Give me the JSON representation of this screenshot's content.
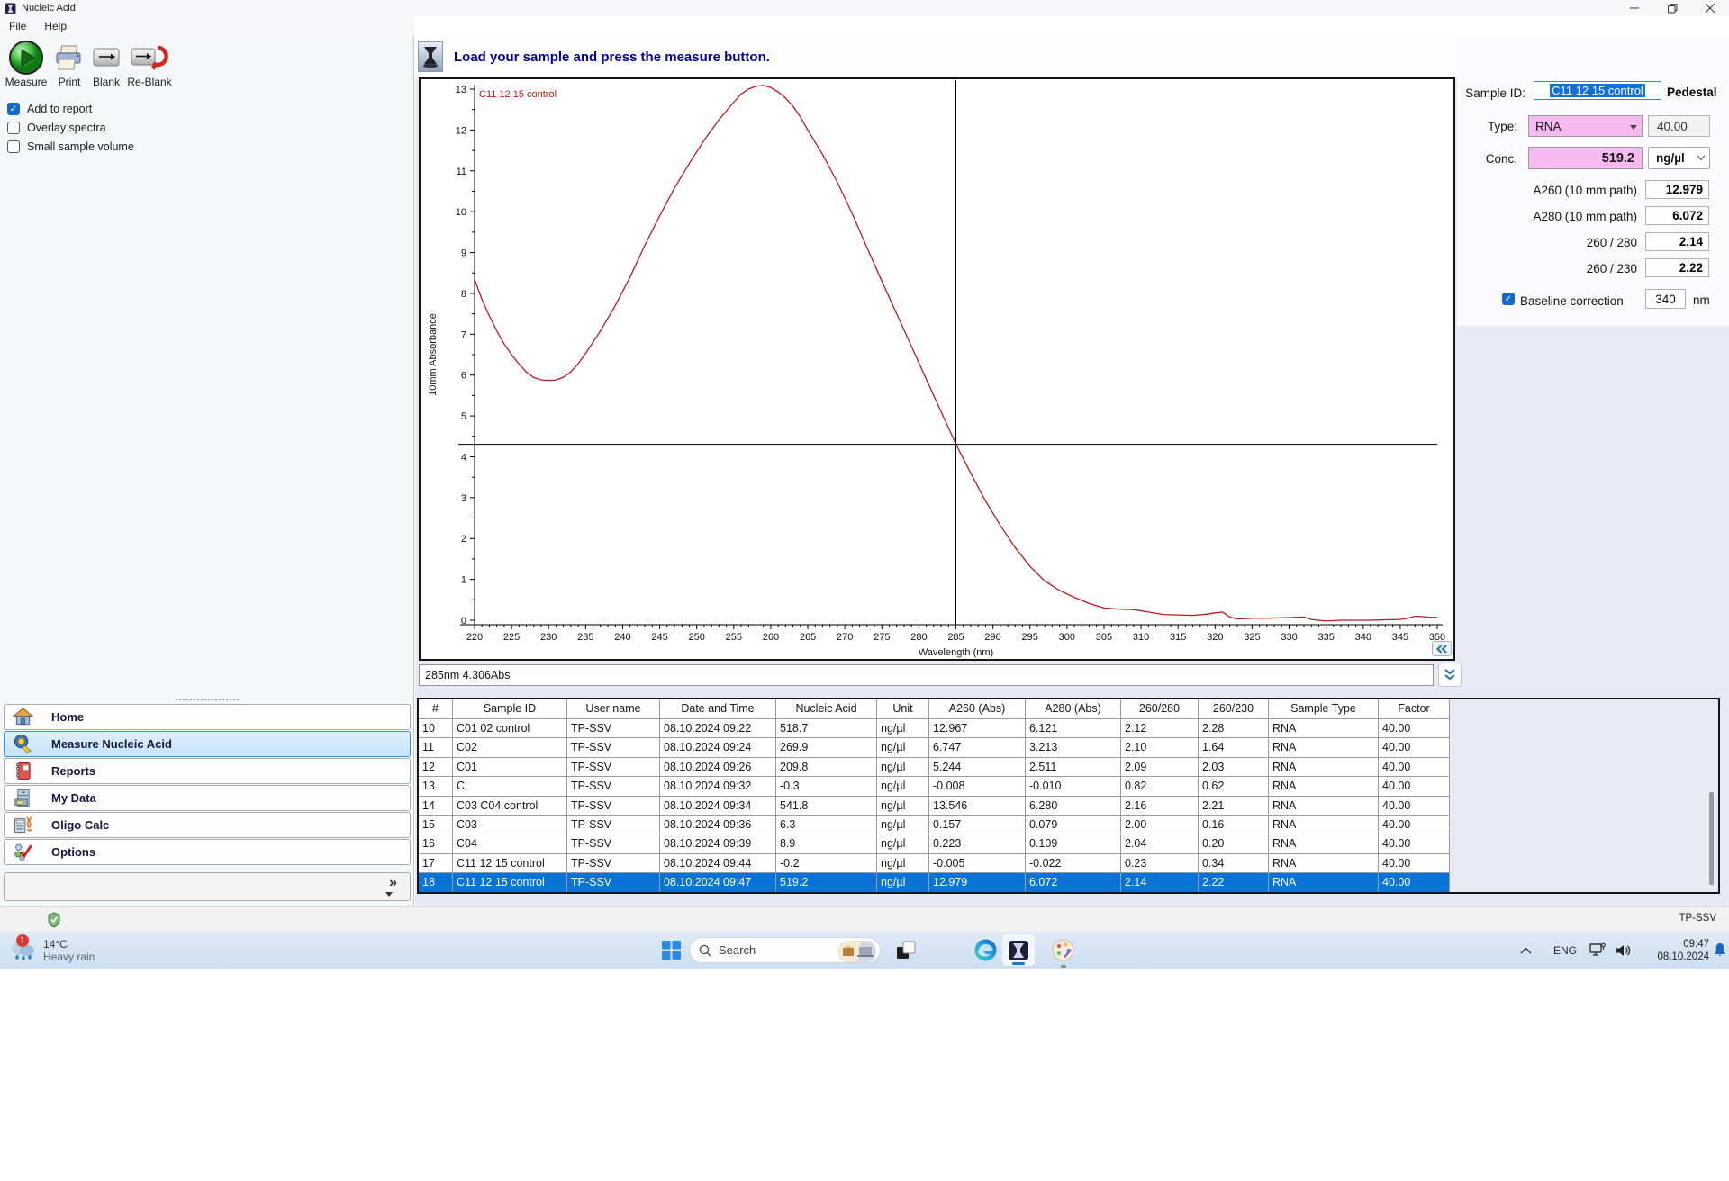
{
  "titlebar": {
    "title": "Nucleic Acid"
  },
  "menu": {
    "items": [
      "File",
      "Help"
    ]
  },
  "toolbar": {
    "buttons": [
      "Measure",
      "Print",
      "Blank",
      "Re-Blank"
    ]
  },
  "left_panel": {
    "checkboxes": [
      {
        "label": "Add to report",
        "checked": true
      },
      {
        "label": "Overlay spectra",
        "checked": false
      },
      {
        "label": "Small sample volume",
        "checked": false
      }
    ]
  },
  "sidebar": {
    "items": [
      {
        "label": "Home",
        "icon": "home-icon",
        "selected": false
      },
      {
        "label": "Measure Nucleic Acid",
        "icon": "measure-tape-icon",
        "selected": true
      },
      {
        "label": "Reports",
        "icon": "report-book-icon",
        "selected": false
      },
      {
        "label": "My Data",
        "icon": "file-cabinet-icon",
        "selected": false
      },
      {
        "label": "Oligo Calc",
        "icon": "calculator-dna-icon",
        "selected": false
      },
      {
        "label": "Options",
        "icon": "options-check-icon",
        "selected": false
      }
    ]
  },
  "message_bar": {
    "text": "Load your sample and press the measure button."
  },
  "chart_data": {
    "type": "line",
    "xlabel": "Wavelength (nm)",
    "ylabel": "10mm Absorbance",
    "xlim": [
      220,
      350
    ],
    "ylim": [
      0,
      13
    ],
    "x_major_tick": 5,
    "y_major_tick": 1,
    "grid": false,
    "legend_position": "top-left",
    "crosshair": {
      "x": 285,
      "y": 4.306
    },
    "series": [
      {
        "name": "C11 12 15 control",
        "color": "#c01818",
        "points": [
          [
            220,
            8.35
          ],
          [
            221,
            7.85
          ],
          [
            222,
            7.45
          ],
          [
            223,
            7.08
          ],
          [
            224,
            6.76
          ],
          [
            225,
            6.5
          ],
          [
            226,
            6.27
          ],
          [
            227,
            6.07
          ],
          [
            228,
            5.94
          ],
          [
            229,
            5.88
          ],
          [
            230,
            5.87
          ],
          [
            231,
            5.88
          ],
          [
            232,
            5.95
          ],
          [
            233,
            6.08
          ],
          [
            234,
            6.28
          ],
          [
            235,
            6.53
          ],
          [
            237,
            7.08
          ],
          [
            239,
            7.7
          ],
          [
            241,
            8.4
          ],
          [
            243,
            9.18
          ],
          [
            245,
            9.9
          ],
          [
            247,
            10.58
          ],
          [
            249,
            11.18
          ],
          [
            251,
            11.75
          ],
          [
            253,
            12.25
          ],
          [
            255,
            12.68
          ],
          [
            256,
            12.88
          ],
          [
            257,
            13.0
          ],
          [
            258,
            13.07
          ],
          [
            259,
            13.09
          ],
          [
            260,
            13.04
          ],
          [
            261,
            12.93
          ],
          [
            262,
            12.78
          ],
          [
            263,
            12.58
          ],
          [
            264,
            12.32
          ],
          [
            265,
            12.0
          ],
          [
            267,
            11.4
          ],
          [
            269,
            10.72
          ],
          [
            271,
            9.95
          ],
          [
            273,
            9.12
          ],
          [
            275,
            8.3
          ],
          [
            277,
            7.5
          ],
          [
            279,
            6.7
          ],
          [
            281,
            5.9
          ],
          [
            283,
            5.1
          ],
          [
            285,
            4.31
          ],
          [
            287,
            3.6
          ],
          [
            289,
            2.92
          ],
          [
            291,
            2.32
          ],
          [
            293,
            1.78
          ],
          [
            295,
            1.32
          ],
          [
            297,
            0.96
          ],
          [
            299,
            0.73
          ],
          [
            301,
            0.56
          ],
          [
            303,
            0.41
          ],
          [
            305,
            0.3
          ],
          [
            307,
            0.27
          ],
          [
            309,
            0.26
          ],
          [
            311,
            0.2
          ],
          [
            313,
            0.14
          ],
          [
            315,
            0.13
          ],
          [
            317,
            0.12
          ],
          [
            319,
            0.15
          ],
          [
            320,
            0.18
          ],
          [
            321,
            0.2
          ],
          [
            322,
            0.08
          ],
          [
            323,
            0.03
          ],
          [
            325,
            0.05
          ],
          [
            327,
            0.05
          ],
          [
            329,
            0.06
          ],
          [
            331,
            0.07
          ],
          [
            332,
            0.08
          ],
          [
            333,
            0.02
          ],
          [
            335,
            -0.02
          ],
          [
            337,
            0.0
          ],
          [
            339,
            0.0
          ],
          [
            341,
            0.0
          ],
          [
            343,
            0.01
          ],
          [
            345,
            0.02
          ],
          [
            346,
            0.05
          ],
          [
            347,
            0.1
          ],
          [
            348,
            0.09
          ],
          [
            349,
            0.07
          ],
          [
            350,
            0.07
          ]
        ]
      }
    ]
  },
  "status_readout": "285nm 4.306Abs",
  "right_panel": {
    "sample_id_label": "Sample ID:",
    "sample_id_value": "C11 12 15 control",
    "mode_label": "Pedestal",
    "type_label": "Type:",
    "type_value": "RNA",
    "factor_value": "40.00",
    "conc_label": "Conc.",
    "conc_value": "519.2",
    "conc_unit": "ng/µl",
    "metrics": [
      {
        "label": "A260 (10 mm path)",
        "value": "12.979"
      },
      {
        "label": "A280 (10 mm path)",
        "value": "6.072"
      },
      {
        "label": "260 / 280",
        "value": "2.14"
      },
      {
        "label": "260 / 230",
        "value": "2.22"
      }
    ],
    "baseline_label": "Baseline correction",
    "baseline_checked": true,
    "baseline_value": "340",
    "baseline_unit": "nm"
  },
  "table": {
    "columns": [
      "#",
      "Sample ID",
      "User name",
      "Date and Time",
      "Nucleic Acid",
      "Unit",
      "A260 (Abs)",
      "A280 (Abs)",
      "260/280",
      "260/230",
      "Sample Type",
      "Factor"
    ],
    "selected_row_index": 8,
    "rows": [
      [
        "10",
        "C01 02 control",
        "TP-SSV",
        "08.10.2024 09:22",
        "518.7",
        "ng/µl",
        "12.967",
        "6.121",
        "2.12",
        "2.28",
        "RNA",
        "40.00"
      ],
      [
        "11",
        "C02",
        "TP-SSV",
        "08.10.2024 09:24",
        "269.9",
        "ng/µl",
        "6.747",
        "3.213",
        "2.10",
        "1.64",
        "RNA",
        "40.00"
      ],
      [
        "12",
        "C01",
        "TP-SSV",
        "08.10.2024 09:26",
        "209.8",
        "ng/µl",
        "5.244",
        "2.511",
        "2.09",
        "2.03",
        "RNA",
        "40.00"
      ],
      [
        "13",
        "C",
        "TP-SSV",
        "08.10.2024 09:32",
        "-0.3",
        "ng/µl",
        "-0.008",
        "-0.010",
        "0.82",
        "0.62",
        "RNA",
        "40.00"
      ],
      [
        "14",
        "C03 C04 control",
        "TP-SSV",
        "08.10.2024 09:34",
        "541.8",
        "ng/µl",
        "13.546",
        "6.280",
        "2.16",
        "2.21",
        "RNA",
        "40.00"
      ],
      [
        "15",
        "C03",
        "TP-SSV",
        "08.10.2024 09:36",
        "6.3",
        "ng/µl",
        "0.157",
        "0.079",
        "2.00",
        "0.16",
        "RNA",
        "40.00"
      ],
      [
        "16",
        "C04",
        "TP-SSV",
        "08.10.2024 09:39",
        "8.9",
        "ng/µl",
        "0.223",
        "0.109",
        "2.04",
        "0.20",
        "RNA",
        "40.00"
      ],
      [
        "17",
        "C11 12 15 control",
        "TP-SSV",
        "08.10.2024 09:44",
        "-0.2",
        "ng/µl",
        "-0.005",
        "-0.022",
        "0.23",
        "0.34",
        "RNA",
        "40.00"
      ],
      [
        "18",
        "C11 12 15 control",
        "TP-SSV",
        "08.10.2024 09:47",
        "519.2",
        "ng/µl",
        "12.979",
        "6.072",
        "2.14",
        "2.22",
        "RNA",
        "40.00"
      ]
    ]
  },
  "statusbar": {
    "user": "TP-SSV"
  },
  "taskbar": {
    "weather": {
      "temp": "14°C",
      "condition": "Heavy rain",
      "badge": "1"
    },
    "search_placeholder": "Search",
    "language": "ENG",
    "time": "09:47",
    "date": "08.10.2024"
  },
  "colors": {
    "accent_blue": "#0b72d8",
    "curve_red": "#c01818",
    "field_pink": "#f6baf0",
    "header_navy": "#000096",
    "teal_chevron": "#2d7d9a"
  }
}
